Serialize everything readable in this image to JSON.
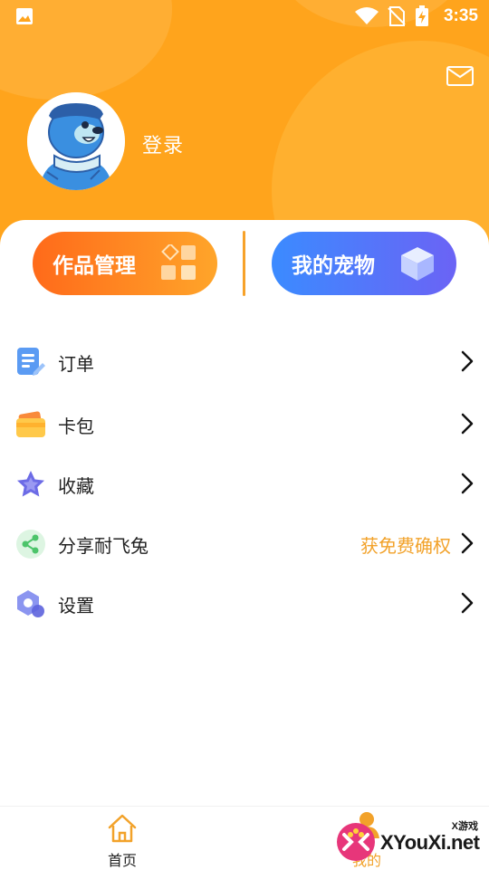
{
  "status_bar": {
    "time": "3:35"
  },
  "profile": {
    "login_label": "登录"
  },
  "quick_actions": {
    "works_label": "作品管理",
    "pet_label": "我的宠物"
  },
  "menu": [
    {
      "label": "订单",
      "icon": "order-icon"
    },
    {
      "label": "卡包",
      "icon": "wallet-icon"
    },
    {
      "label": "收藏",
      "icon": "star-icon"
    },
    {
      "label": "分享耐飞兔",
      "icon": "share-icon",
      "extra": "获免费确权"
    },
    {
      "label": "设置",
      "icon": "settings-icon"
    }
  ],
  "tabs": {
    "home": "首页",
    "mine": "我的"
  },
  "watermark": {
    "site": "XYouXi.net",
    "tag": "X游戏"
  },
  "colors": {
    "accent": "#FFA41C",
    "orange": "#FF6A1A",
    "blue": "#3B8BFF",
    "extra_text": "#F2A22A"
  }
}
